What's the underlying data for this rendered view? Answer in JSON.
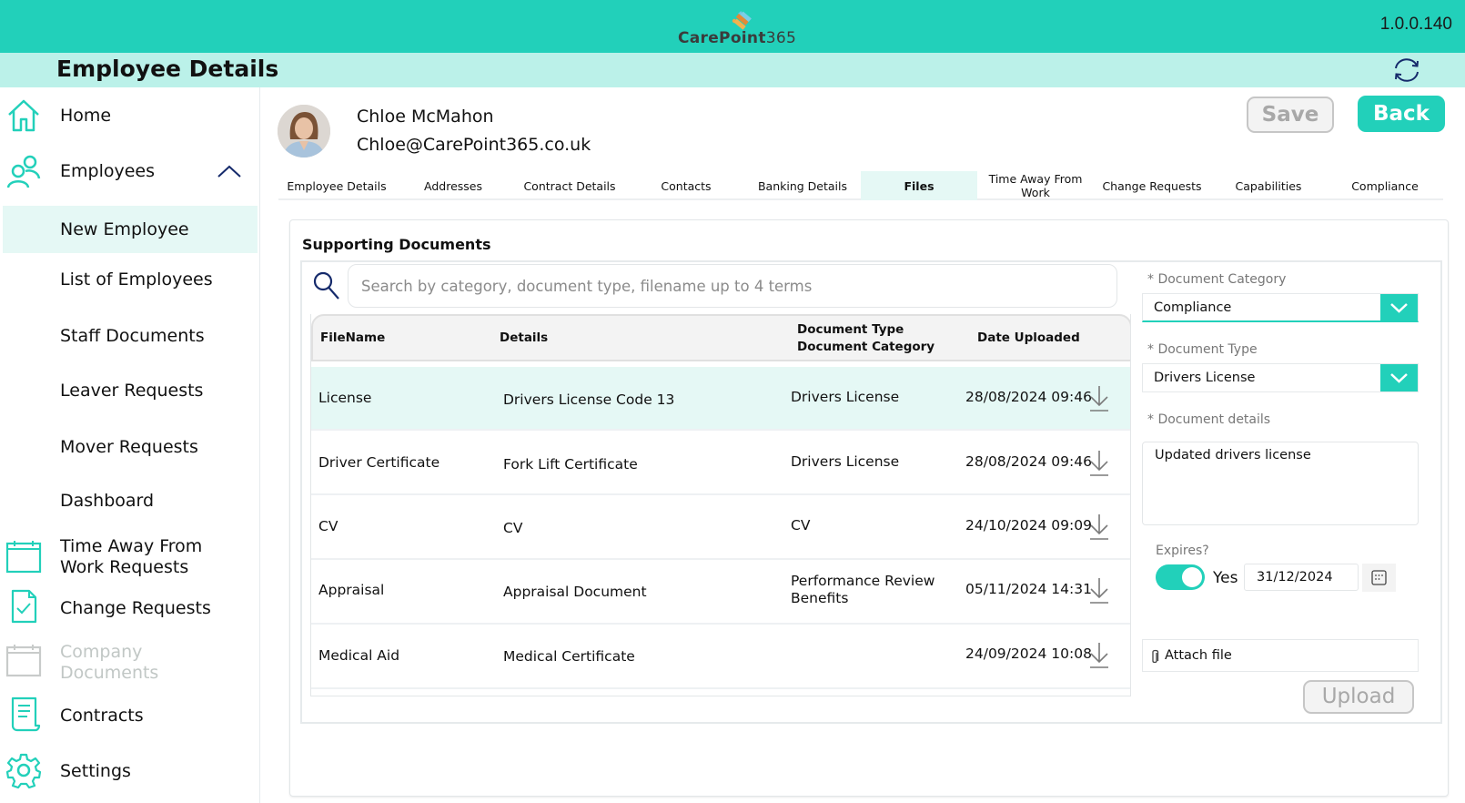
{
  "app": {
    "logo_bold": "CarePoint",
    "logo_light": "365",
    "version": "1.0.0.140",
    "page_title": "Employee Details",
    "accent": "#22d0ba",
    "title_bg": "#bbf1e9"
  },
  "sidebar": {
    "items": [
      {
        "label": "Home",
        "icon": "home-icon"
      },
      {
        "label": "Employees",
        "icon": "users-icon",
        "expanded": true
      },
      {
        "label": "New Employee",
        "active": true
      },
      {
        "label": "List of Employees"
      },
      {
        "label": "Staff Documents"
      },
      {
        "label": "Leaver Requests"
      },
      {
        "label": "Mover Requests"
      },
      {
        "label": "Dashboard"
      },
      {
        "label": "Time Away From Work Requests",
        "icon": "calendar-icon"
      },
      {
        "label": "Change Requests",
        "icon": "document-check-icon"
      },
      {
        "label": "Company Documents",
        "icon": "calendar-icon",
        "disabled": true
      },
      {
        "label": "Contracts",
        "icon": "contract-icon"
      },
      {
        "label": "Settings",
        "icon": "gear-icon"
      }
    ]
  },
  "employee": {
    "name": "Chloe McMahon",
    "email": "Chloe@CarePoint365.co.uk"
  },
  "toolbar": {
    "save_label": "Save",
    "back_label": "Back"
  },
  "tabs": [
    {
      "label": "Employee Details"
    },
    {
      "label": "Addresses"
    },
    {
      "label": "Contract Details"
    },
    {
      "label": "Contacts"
    },
    {
      "label": "Banking Details"
    },
    {
      "label": "Files",
      "active": true
    },
    {
      "label": "Time Away From Work"
    },
    {
      "label": "Change Requests"
    },
    {
      "label": "Capabilities"
    },
    {
      "label": "Compliance"
    }
  ],
  "documents": {
    "section_title": "Supporting Documents",
    "search_placeholder": "Search by category, document type, filename up to 4 terms",
    "search_value": "",
    "columns": {
      "filename": "FileName",
      "details": "Details",
      "doc_type": "Document Type",
      "doc_category": "Document Category",
      "date": "Date Uploaded"
    },
    "rows": [
      {
        "filename": "License",
        "details": "Drivers License Code 13",
        "type_category": "Drivers License",
        "date": "28/08/2024 09:46",
        "selected": true
      },
      {
        "filename": "Driver Certificate",
        "details": "Fork Lift Certificate",
        "type_category": "Drivers License",
        "date": "28/08/2024 09:46"
      },
      {
        "filename": "CV",
        "details": "CV",
        "type_category": "CV",
        "date": "24/10/2024 09:09"
      },
      {
        "filename": "Appraisal",
        "details": "Appraisal Document",
        "type_category": "Performance Review Benefits",
        "date": "05/11/2024 14:31"
      },
      {
        "filename": "Medical Aid",
        "details": "Medical Certificate",
        "type_category": "",
        "date": "24/09/2024 10:08"
      }
    ]
  },
  "form": {
    "category_label": "* Document Category",
    "category_value": "Compliance",
    "type_label": "* Document Type",
    "type_value": "Drivers License",
    "details_label": "* Document details",
    "details_value": "Updated drivers license",
    "expires_label": "Expires?",
    "expires_on": true,
    "expires_toggle_label": "Yes",
    "expiry_date": "31/12/2024",
    "attach_label": "Attach file",
    "upload_label": "Upload"
  }
}
